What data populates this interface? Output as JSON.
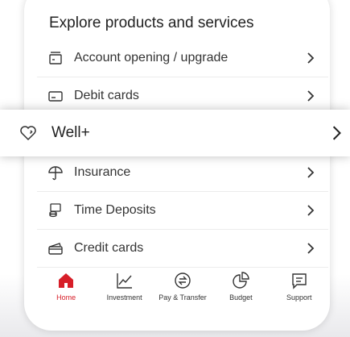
{
  "section": {
    "title": "Explore products and services"
  },
  "items": [
    {
      "label": "Account opening / upgrade",
      "icon": "account-opening-icon"
    },
    {
      "label": "Debit cards",
      "icon": "debit-card-icon"
    },
    {
      "label": "Well+",
      "icon": "heart-icon"
    },
    {
      "label": "Insurance",
      "icon": "umbrella-icon"
    },
    {
      "label": "Time Deposits",
      "icon": "coins-icon"
    },
    {
      "label": "Credit cards",
      "icon": "credit-card-icon"
    }
  ],
  "navbar": {
    "active": "Home",
    "accent_color": "#d71e28",
    "items": [
      {
        "label": "Home",
        "icon": "home-icon"
      },
      {
        "label": "Investment",
        "icon": "chart-icon"
      },
      {
        "label": "Pay & Transfer",
        "icon": "transfer-icon"
      },
      {
        "label": "Budget",
        "icon": "pie-chart-icon"
      },
      {
        "label": "Support",
        "icon": "chat-icon"
      }
    ]
  }
}
